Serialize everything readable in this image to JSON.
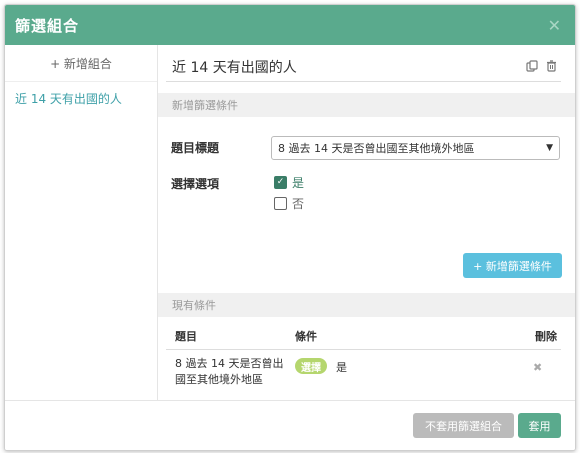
{
  "modal": {
    "title": "篩選組合",
    "close_icon": "close-icon"
  },
  "sidebar": {
    "add_label": "+ 新增組合",
    "items": [
      {
        "label": "近 14 天有出國的人",
        "active": true
      }
    ]
  },
  "combo": {
    "name": "近 14 天有出國的人",
    "copy_icon": "copy-icon",
    "delete_icon": "trash-icon"
  },
  "new_condition": {
    "section_title": "新增篩選條件",
    "question_label": "題目標題",
    "question_value": "8 過去 14 天是否曾出國至其他境外地區",
    "options_label": "選擇選項",
    "options": [
      {
        "label": "是",
        "checked": true
      },
      {
        "label": "否",
        "checked": false
      }
    ],
    "add_button": "+ 新增篩選條件"
  },
  "existing": {
    "section_title": "現有條件",
    "headers": {
      "question": "題目",
      "condition": "條件",
      "delete": "刪除"
    },
    "rows": [
      {
        "question": "8 過去 14 天是否曾出國至其他境外地區",
        "badge": "選擇",
        "answer": "是"
      }
    ]
  },
  "footer": {
    "disable_button": "不套用篩選組合",
    "apply_button": "套用"
  },
  "colors": {
    "header": "#5aaa8d",
    "link": "#3ea0a8",
    "info_button": "#5bc0de",
    "badge": "#b5d66e",
    "disabled_button": "#bbbbbb"
  }
}
